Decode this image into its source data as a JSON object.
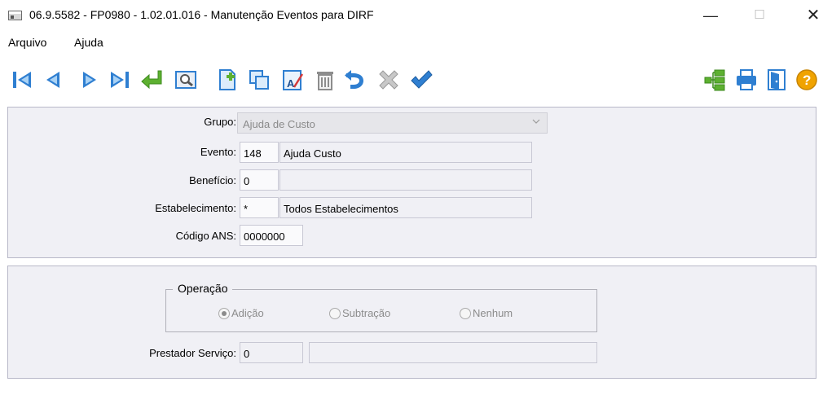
{
  "window": {
    "title": "06.9.5582 - FP0980 - 1.02.01.016 - Manutenção Eventos para DIRF",
    "buttons": {
      "minimize": "—",
      "maximize": "☐",
      "close": "✕"
    }
  },
  "menu": {
    "file": "Arquivo",
    "help": "Ajuda"
  },
  "toolbar": {
    "icons": [
      "first-icon",
      "previous-icon",
      "next-icon",
      "last-icon",
      "go-to-icon",
      "search-icon",
      "new-icon",
      "copy-icon",
      "edit-icon",
      "delete-icon",
      "undo-icon",
      "cancel-icon",
      "save-icon",
      "tree-icon",
      "print-icon",
      "exit-icon",
      "help-icon"
    ],
    "colors": {
      "blue": "#2f7fd1",
      "green": "#5db030",
      "gold": "#f0a300",
      "gray": "#8d8d8d"
    }
  },
  "form": {
    "grupo": {
      "label": "Grupo:",
      "value": "Ajuda de Custo"
    },
    "evento": {
      "label": "Evento:",
      "code": "148",
      "desc": "Ajuda Custo"
    },
    "beneficio": {
      "label": "Benefício:",
      "code": "0",
      "desc": ""
    },
    "estabelecimento": {
      "label": "Estabelecimento:",
      "code": "*",
      "desc": "Todos Estabelecimentos"
    },
    "codigo_ans": {
      "label": "Código ANS:",
      "value": "0000000"
    }
  },
  "operacao": {
    "legend": "Operação",
    "options": [
      {
        "label": "Adição",
        "checked": true
      },
      {
        "label": "Subtração",
        "checked": false
      },
      {
        "label": "Nenhum",
        "checked": false
      }
    ]
  },
  "prestador": {
    "label": "Prestador Serviço:",
    "code": "0",
    "desc": ""
  }
}
